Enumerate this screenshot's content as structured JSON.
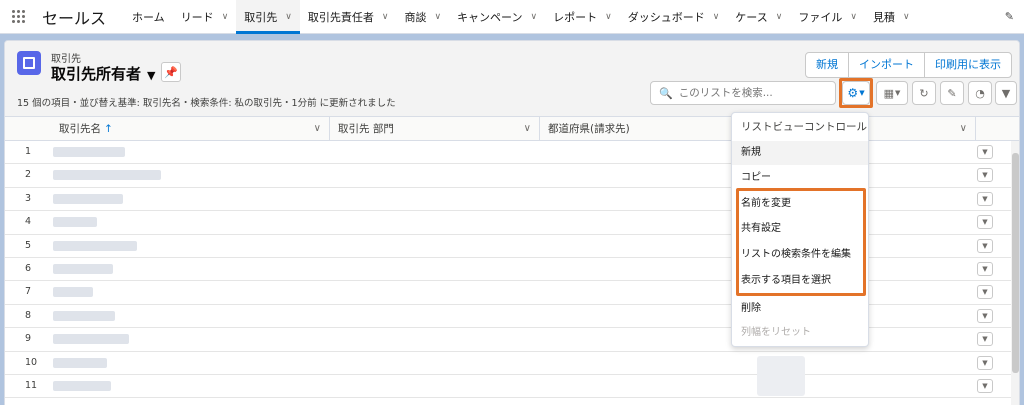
{
  "nav": {
    "app_name": "セールス",
    "items": [
      {
        "label": "ホーム",
        "has_menu": false
      },
      {
        "label": "リード",
        "has_menu": true
      },
      {
        "label": "取引先",
        "has_menu": true,
        "active": true
      },
      {
        "label": "取引先責任者",
        "has_menu": true
      },
      {
        "label": "商談",
        "has_menu": true
      },
      {
        "label": "キャンペーン",
        "has_menu": true
      },
      {
        "label": "レポート",
        "has_menu": true
      },
      {
        "label": "ダッシュボード",
        "has_menu": true
      },
      {
        "label": "ケース",
        "has_menu": true
      },
      {
        "label": "ファイル",
        "has_menu": true
      },
      {
        "label": "見積",
        "has_menu": true
      }
    ]
  },
  "header": {
    "object_label": "取引先",
    "list_view_name": "取引先所有者",
    "buttons": [
      "新規",
      "インポート",
      "印刷用に表示"
    ],
    "status_text": "15 個の項目・並び替え基準: 取引先名・検索条件: 私の取引先・1分前 に更新されました",
    "search_placeholder": "このリストを検索..."
  },
  "table": {
    "columns": [
      {
        "label": "取引先名",
        "sorted": "asc"
      },
      {
        "label": "取引先 部門"
      },
      {
        "label": "都道府県(請求先)"
      }
    ],
    "rows": [
      {
        "num": "1"
      },
      {
        "num": "2"
      },
      {
        "num": "3"
      },
      {
        "num": "4"
      },
      {
        "num": "5"
      },
      {
        "num": "6"
      },
      {
        "num": "7"
      },
      {
        "num": "8"
      },
      {
        "num": "9"
      },
      {
        "num": "10"
      },
      {
        "num": "11"
      }
    ]
  },
  "menu": {
    "header": "リストビューコントロール",
    "items": [
      {
        "label": "新規",
        "state": "hover"
      },
      {
        "label": "コピー"
      },
      {
        "label": "名前を変更",
        "highlighted": true
      },
      {
        "label": "共有設定",
        "highlighted": true
      },
      {
        "label": "リストの検索条件を編集",
        "highlighted": true
      },
      {
        "label": "表示する項目を選択",
        "highlighted": true
      },
      {
        "label": "削除"
      },
      {
        "label": "列幅をリセット",
        "state": "disabled"
      }
    ]
  },
  "colors": {
    "brand_blue": "#0176d3",
    "highlight_orange": "#e37329",
    "object_icon": "#5867e8",
    "page_background": "#b0c4df"
  }
}
